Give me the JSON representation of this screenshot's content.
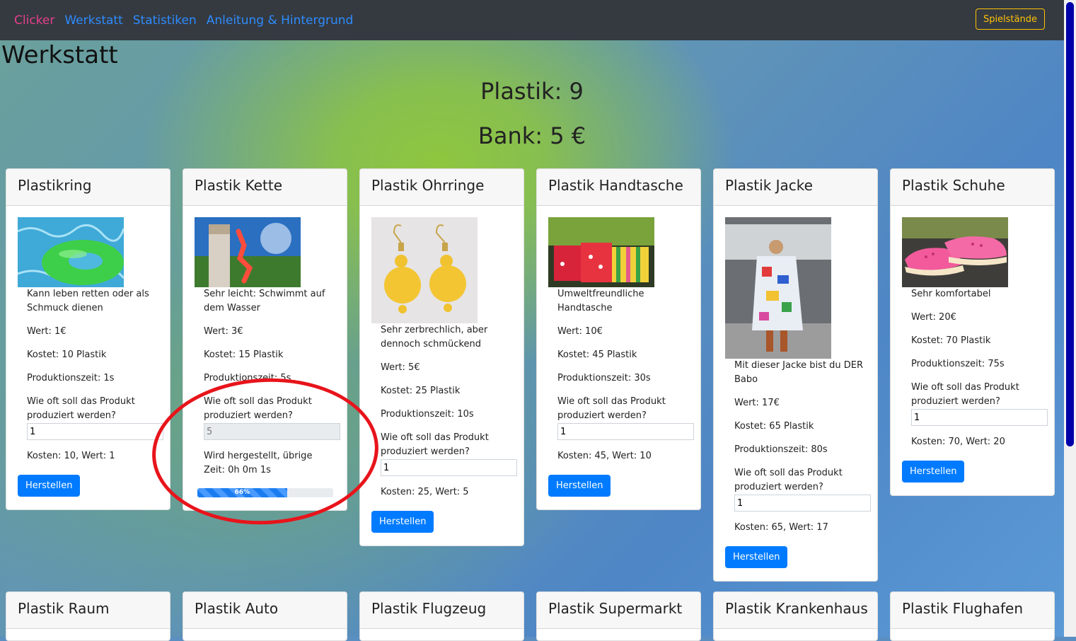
{
  "nav": {
    "brand": "Clicker",
    "links": [
      "Werkstatt",
      "Statistiken",
      "Anleitung & Hintergrund"
    ],
    "right_button": "Spielstände"
  },
  "page": {
    "title": "Werkstatt",
    "plastik": "Plastik: 9",
    "bank": "Bank: 5 €"
  },
  "labels": {
    "question": "Wie oft soll das Produkt produziert werden?",
    "button": "Herstellen"
  },
  "products": [
    {
      "title": "Plastikring",
      "desc": "Kann leben retten oder als Schmuck dienen",
      "wert": "Wert: 1€",
      "kostet": "Kostet: 10 Plastik",
      "zeit": "Produktionszeit: 1s",
      "input": "1",
      "summary": "Kosten: 10, Wert: 1",
      "image": "swim-ring-image"
    },
    {
      "title": "Plastik Kette",
      "desc": "Sehr leicht: Schwimmt auf dem Wasser",
      "wert": "Wert: 3€",
      "kostet": "Kostet: 15 Plastik",
      "zeit": "Produktionszeit: 5s",
      "input": "5",
      "status": "Wird hergestellt, übrige Zeit: 0h 0m 1s",
      "progress_label": "66%",
      "progress": 0.66,
      "image": "plastic-chain-image"
    },
    {
      "title": "Plastik Ohrringe",
      "desc": "Sehr zerbrechlich, aber dennoch schmückend",
      "wert": "Wert: 5€",
      "kostet": "Kostet: 25 Plastik",
      "zeit": "Produktionszeit: 10s",
      "input": "1",
      "summary": "Kosten: 25, Wert: 5",
      "image": "earrings-image"
    },
    {
      "title": "Plastik Handtasche",
      "desc": "Umweltfreundliche Handtasche",
      "wert": "Wert: 10€",
      "kostet": "Kostet: 45 Plastik",
      "zeit": "Produktionszeit: 30s",
      "input": "1",
      "summary": "Kosten: 45, Wert: 10",
      "image": "handbag-image"
    },
    {
      "title": "Plastik Jacke",
      "desc": "Mit dieser Jacke bist du DER Babo",
      "wert": "Wert: 17€",
      "kostet": "Kostet: 65 Plastik",
      "zeit": "Produktionszeit: 80s",
      "input": "1",
      "summary": "Kosten: 65, Wert: 17",
      "image": "jacket-image"
    },
    {
      "title": "Plastik Schuhe",
      "desc": "Sehr komfortabel",
      "wert": "Wert: 20€",
      "kostet": "Kostet: 70 Plastik",
      "zeit": "Produktionszeit: 75s",
      "input": "1",
      "summary": "Kosten: 70, Wert: 20",
      "image": "shoes-image"
    }
  ],
  "row2": [
    "Plastik Raum",
    "Plastik Auto",
    "Plastik Flugzeug",
    "Plastik Supermarkt",
    "Plastik Krankenhaus",
    "Plastik Flughafen"
  ]
}
